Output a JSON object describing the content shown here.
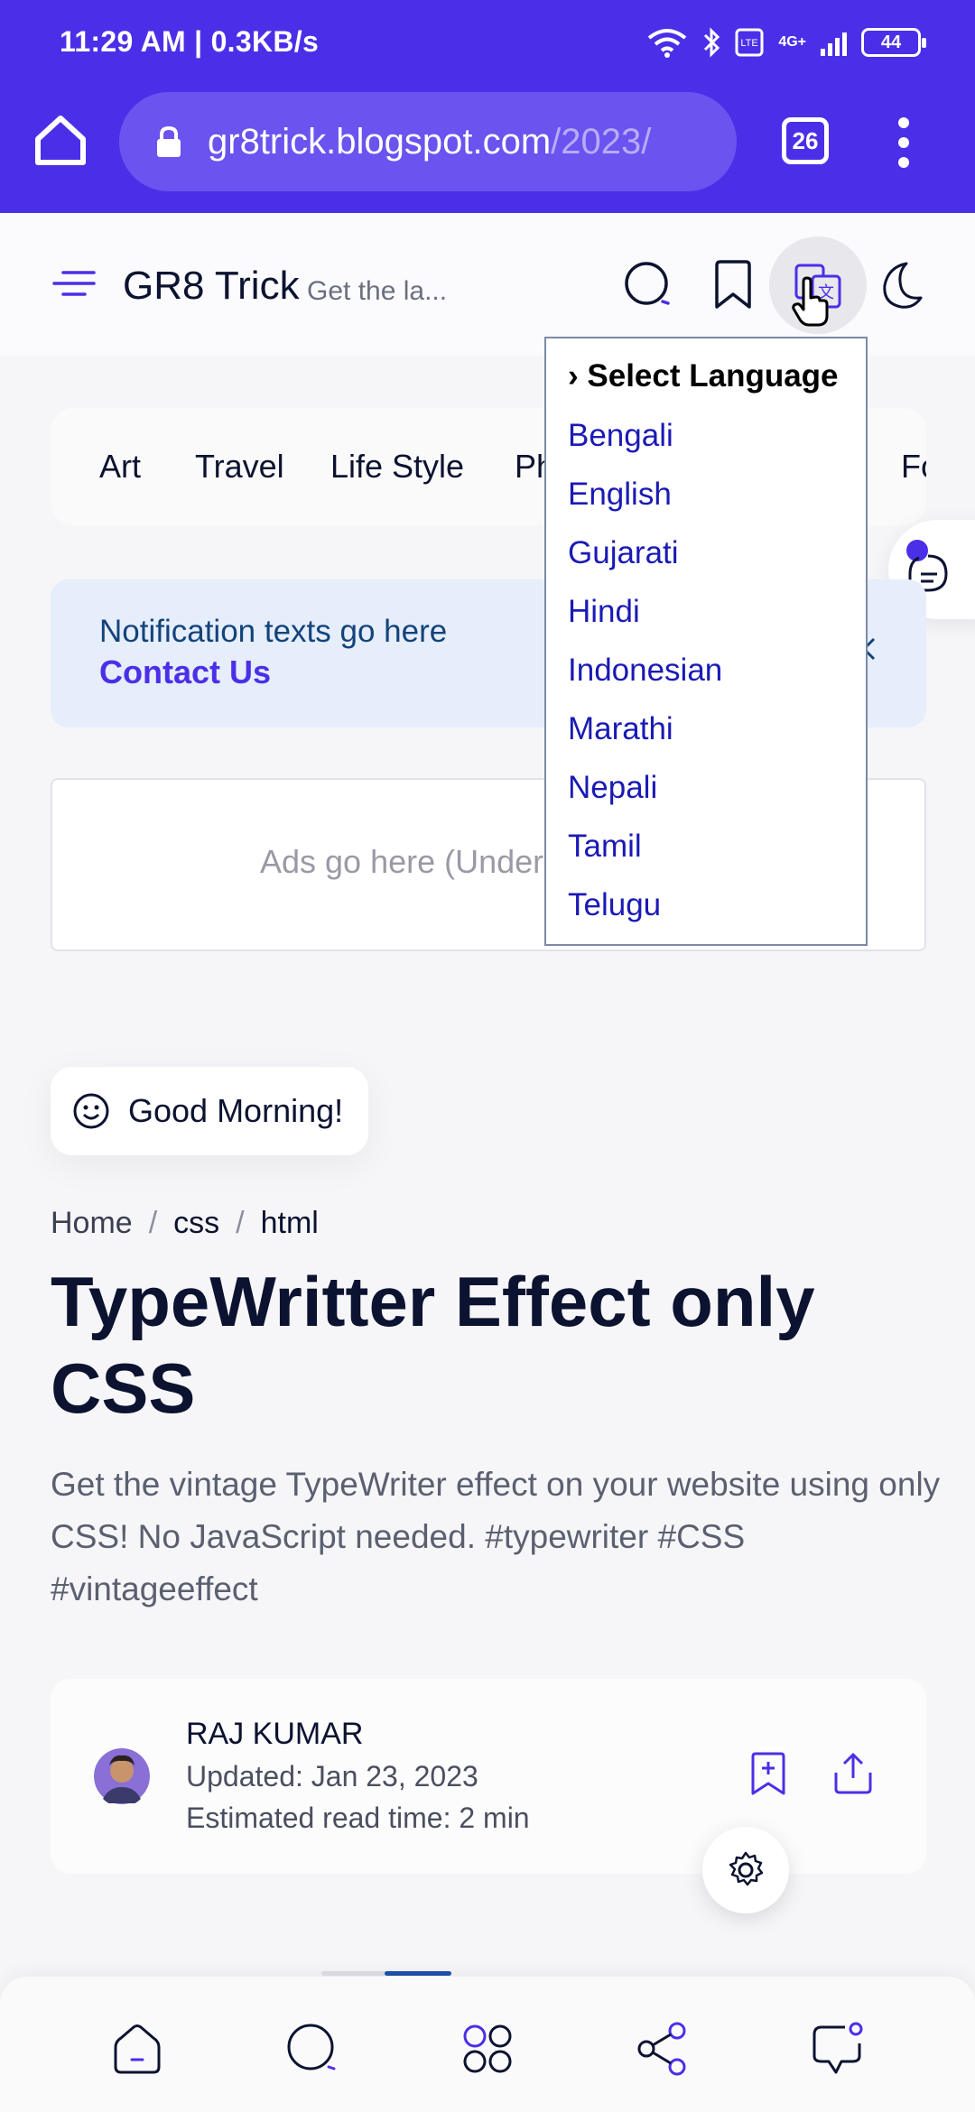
{
  "status_bar": {
    "time": "11:29 AM | 0.3KB/s",
    "battery": "44",
    "network": "4G+"
  },
  "browser": {
    "url_main": "gr8trick.blogspot.com",
    "url_rest": "/2023/",
    "tab_count": "26"
  },
  "header": {
    "brand": "GR8 Trick",
    "tagline": "Get the la..."
  },
  "categories": [
    "Art",
    "Travel",
    "Life Style",
    "Ph",
    "Fo"
  ],
  "notification": {
    "text": "Notification texts go here",
    "link": "Contact Us"
  },
  "ads": {
    "text": "Ads go here (Under"
  },
  "greeting": "Good Morning!",
  "breadcrumb": [
    "Home",
    "css",
    "html"
  ],
  "article": {
    "title": "TypeWritter Effect only CSS",
    "description": "Get the vintage TypeWriter effect on your website using only CSS! No JavaScript needed. #typewriter #CSS #vintageeffect"
  },
  "author": {
    "name": "RAJ KUMAR",
    "updated": "Updated: Jan 23, 2023",
    "read_time": "Estimated read time: 2 min"
  },
  "language_menu": {
    "header": "› Select Language",
    "options": [
      "Bengali",
      "English",
      "Gujarati",
      "Hindi",
      "Indonesian",
      "Marathi",
      "Nepali",
      "Tamil",
      "Telugu"
    ]
  },
  "colors": {
    "browser_bar": "#4b2fe8",
    "accent": "#4b2fe8",
    "link_blue": "#1a1ab5"
  }
}
